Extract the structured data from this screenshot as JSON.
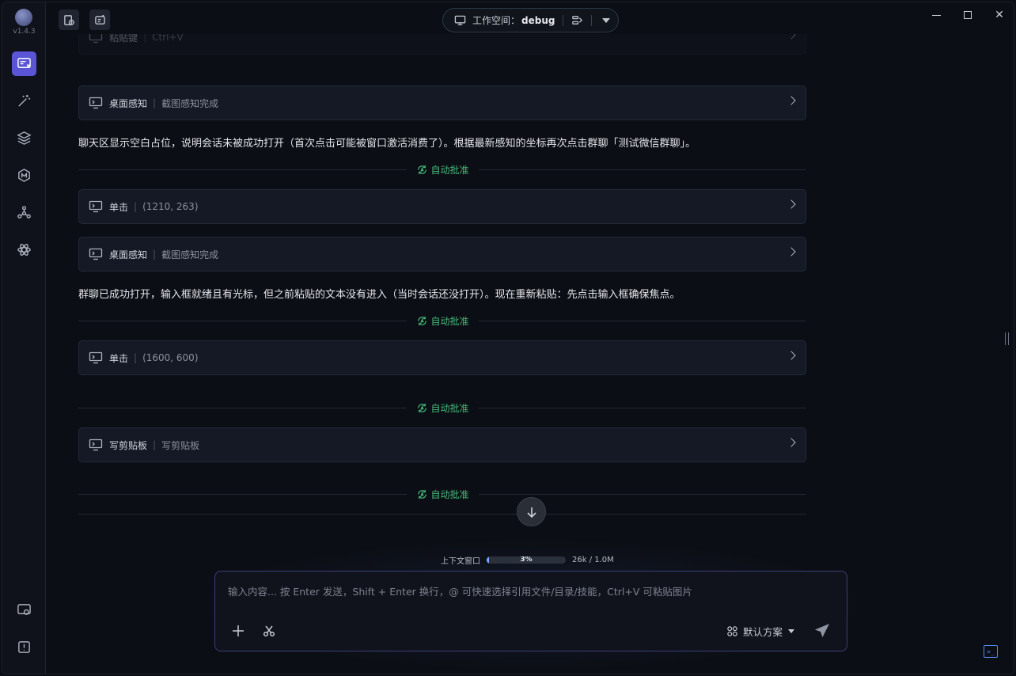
{
  "app": {
    "version": "v1.4.3"
  },
  "workspace": {
    "label": "工作空间：",
    "name": "debug"
  },
  "sidebar": {
    "items": [
      {
        "icon": "chat-icon",
        "active": true
      },
      {
        "icon": "magic-wand-icon",
        "active": false
      },
      {
        "icon": "layers-icon",
        "active": false
      },
      {
        "icon": "model-icon",
        "active": false
      },
      {
        "icon": "network-icon",
        "active": false
      },
      {
        "icon": "atom-icon",
        "active": false
      }
    ],
    "bottom": [
      {
        "icon": "settings-icon"
      },
      {
        "icon": "info-icon"
      }
    ]
  },
  "conversation": {
    "partial_card": {
      "name": "粘贴键",
      "detail": "Ctrl+V"
    },
    "cards": [
      {
        "name": "桌面感知",
        "detail": "截图感知完成"
      },
      {
        "name": "单击",
        "detail": "(1210, 263)"
      },
      {
        "name": "桌面感知",
        "detail": "截图感知完成"
      },
      {
        "name": "单击",
        "detail": "(1600, 600)"
      },
      {
        "name": "写剪贴板",
        "detail": "写剪贴板"
      }
    ],
    "messages": [
      "聊天区显示空白占位，说明会话未被成功打开（首次点击可能被窗口激活消费了）。根据最新感知的坐标再次点击群聊「测试微信群聊」。",
      "群聊已成功打开，输入框就绪且有光标，但之前粘贴的文本没有进入（当时会话还没打开）。现在重新粘贴：先点击输入框确保焦点。"
    ],
    "auto_approve_label": "自动批准"
  },
  "context": {
    "label": "上下文窗口",
    "percent_label": "3%",
    "percent": 0.03,
    "usage": "26k / 1.0M"
  },
  "composer": {
    "placeholder": "输入内容... 按 Enter 发送，Shift + Enter 换行，@ 可快速选择引用文件/目录/技能，Ctrl+V 可粘贴图片",
    "plan_label": "默认方案"
  },
  "colors": {
    "accent": "#5a54d6",
    "approve": "#47b87a",
    "progress": "#7fa8ff"
  }
}
